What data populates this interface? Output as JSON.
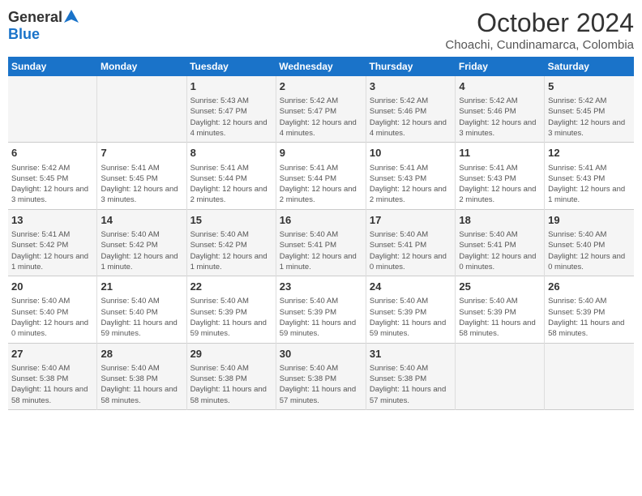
{
  "header": {
    "logo_general": "General",
    "logo_blue": "Blue",
    "month": "October 2024",
    "location": "Choachi, Cundinamarca, Colombia"
  },
  "days_of_week": [
    "Sunday",
    "Monday",
    "Tuesday",
    "Wednesday",
    "Thursday",
    "Friday",
    "Saturday"
  ],
  "weeks": [
    [
      {
        "day": "",
        "info": ""
      },
      {
        "day": "",
        "info": ""
      },
      {
        "day": "1",
        "info": "Sunrise: 5:43 AM\nSunset: 5:47 PM\nDaylight: 12 hours and 4 minutes."
      },
      {
        "day": "2",
        "info": "Sunrise: 5:42 AM\nSunset: 5:47 PM\nDaylight: 12 hours and 4 minutes."
      },
      {
        "day": "3",
        "info": "Sunrise: 5:42 AM\nSunset: 5:46 PM\nDaylight: 12 hours and 4 minutes."
      },
      {
        "day": "4",
        "info": "Sunrise: 5:42 AM\nSunset: 5:46 PM\nDaylight: 12 hours and 3 minutes."
      },
      {
        "day": "5",
        "info": "Sunrise: 5:42 AM\nSunset: 5:45 PM\nDaylight: 12 hours and 3 minutes."
      }
    ],
    [
      {
        "day": "6",
        "info": "Sunrise: 5:42 AM\nSunset: 5:45 PM\nDaylight: 12 hours and 3 minutes."
      },
      {
        "day": "7",
        "info": "Sunrise: 5:41 AM\nSunset: 5:45 PM\nDaylight: 12 hours and 3 minutes."
      },
      {
        "day": "8",
        "info": "Sunrise: 5:41 AM\nSunset: 5:44 PM\nDaylight: 12 hours and 2 minutes."
      },
      {
        "day": "9",
        "info": "Sunrise: 5:41 AM\nSunset: 5:44 PM\nDaylight: 12 hours and 2 minutes."
      },
      {
        "day": "10",
        "info": "Sunrise: 5:41 AM\nSunset: 5:43 PM\nDaylight: 12 hours and 2 minutes."
      },
      {
        "day": "11",
        "info": "Sunrise: 5:41 AM\nSunset: 5:43 PM\nDaylight: 12 hours and 2 minutes."
      },
      {
        "day": "12",
        "info": "Sunrise: 5:41 AM\nSunset: 5:43 PM\nDaylight: 12 hours and 1 minute."
      }
    ],
    [
      {
        "day": "13",
        "info": "Sunrise: 5:41 AM\nSunset: 5:42 PM\nDaylight: 12 hours and 1 minute."
      },
      {
        "day": "14",
        "info": "Sunrise: 5:40 AM\nSunset: 5:42 PM\nDaylight: 12 hours and 1 minute."
      },
      {
        "day": "15",
        "info": "Sunrise: 5:40 AM\nSunset: 5:42 PM\nDaylight: 12 hours and 1 minute."
      },
      {
        "day": "16",
        "info": "Sunrise: 5:40 AM\nSunset: 5:41 PM\nDaylight: 12 hours and 1 minute."
      },
      {
        "day": "17",
        "info": "Sunrise: 5:40 AM\nSunset: 5:41 PM\nDaylight: 12 hours and 0 minutes."
      },
      {
        "day": "18",
        "info": "Sunrise: 5:40 AM\nSunset: 5:41 PM\nDaylight: 12 hours and 0 minutes."
      },
      {
        "day": "19",
        "info": "Sunrise: 5:40 AM\nSunset: 5:40 PM\nDaylight: 12 hours and 0 minutes."
      }
    ],
    [
      {
        "day": "20",
        "info": "Sunrise: 5:40 AM\nSunset: 5:40 PM\nDaylight: 12 hours and 0 minutes."
      },
      {
        "day": "21",
        "info": "Sunrise: 5:40 AM\nSunset: 5:40 PM\nDaylight: 11 hours and 59 minutes."
      },
      {
        "day": "22",
        "info": "Sunrise: 5:40 AM\nSunset: 5:39 PM\nDaylight: 11 hours and 59 minutes."
      },
      {
        "day": "23",
        "info": "Sunrise: 5:40 AM\nSunset: 5:39 PM\nDaylight: 11 hours and 59 minutes."
      },
      {
        "day": "24",
        "info": "Sunrise: 5:40 AM\nSunset: 5:39 PM\nDaylight: 11 hours and 59 minutes."
      },
      {
        "day": "25",
        "info": "Sunrise: 5:40 AM\nSunset: 5:39 PM\nDaylight: 11 hours and 58 minutes."
      },
      {
        "day": "26",
        "info": "Sunrise: 5:40 AM\nSunset: 5:39 PM\nDaylight: 11 hours and 58 minutes."
      }
    ],
    [
      {
        "day": "27",
        "info": "Sunrise: 5:40 AM\nSunset: 5:38 PM\nDaylight: 11 hours and 58 minutes."
      },
      {
        "day": "28",
        "info": "Sunrise: 5:40 AM\nSunset: 5:38 PM\nDaylight: 11 hours and 58 minutes."
      },
      {
        "day": "29",
        "info": "Sunrise: 5:40 AM\nSunset: 5:38 PM\nDaylight: 11 hours and 58 minutes."
      },
      {
        "day": "30",
        "info": "Sunrise: 5:40 AM\nSunset: 5:38 PM\nDaylight: 11 hours and 57 minutes."
      },
      {
        "day": "31",
        "info": "Sunrise: 5:40 AM\nSunset: 5:38 PM\nDaylight: 11 hours and 57 minutes."
      },
      {
        "day": "",
        "info": ""
      },
      {
        "day": "",
        "info": ""
      }
    ]
  ]
}
